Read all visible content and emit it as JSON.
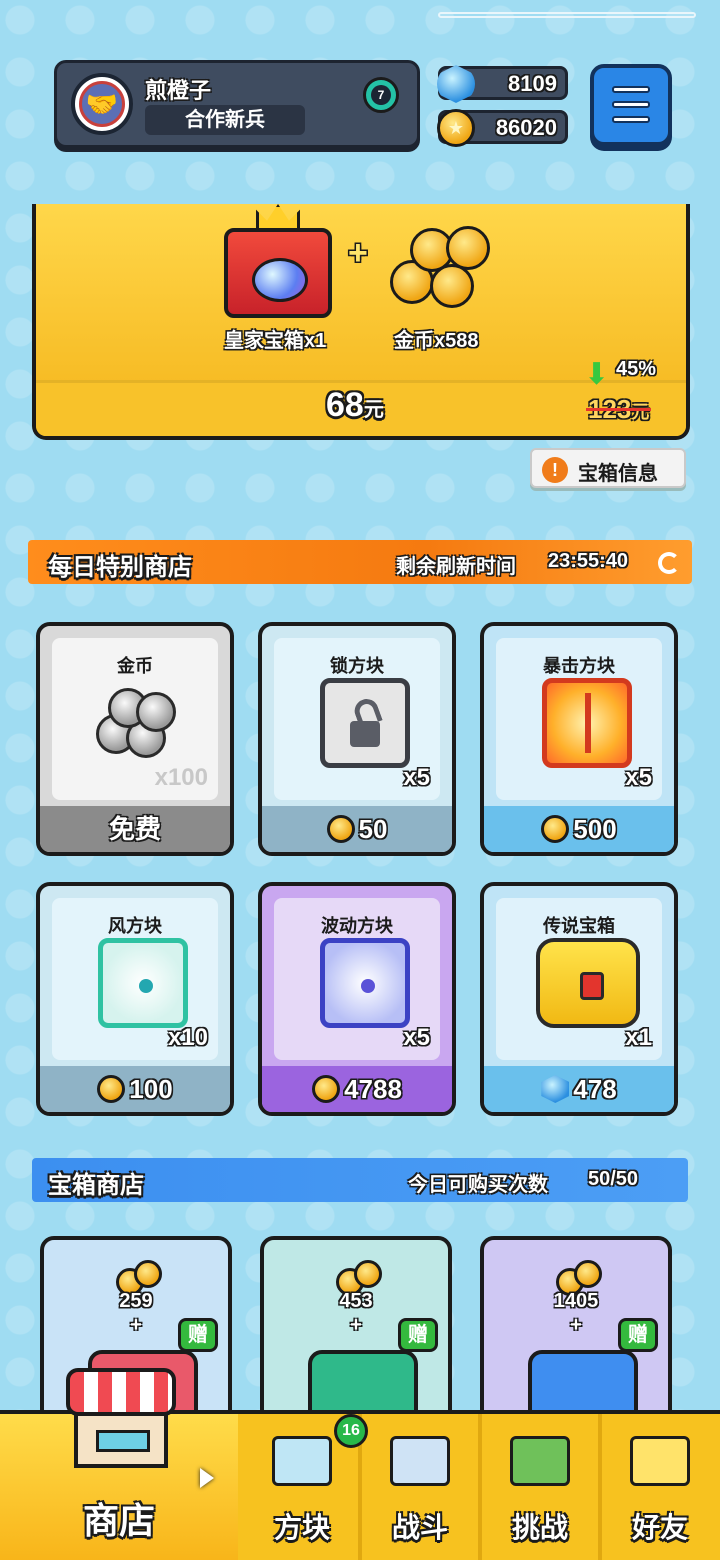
{
  "player": {
    "name": "煎橙子",
    "rank": "合作新兵",
    "level_badge": "7"
  },
  "currency": {
    "gems": "8109",
    "coins": "86020"
  },
  "offer": {
    "item1_label": "皇家宝箱x1",
    "item2_label": "金币x588",
    "price": "68",
    "price_unit": "元",
    "discount": "45%",
    "original_price": "123",
    "original_unit": "元"
  },
  "chest_info_label": "宝箱信息",
  "daily_shop": {
    "title": "每日特别商店",
    "refresh_label": "剩余刷新时间",
    "refresh_time": "23:55:40",
    "items": [
      {
        "name": "金币",
        "qty": "x100",
        "price": "免费",
        "icon": "silver-coins-icon",
        "currency": "none"
      },
      {
        "name": "锁方块",
        "qty": "x5",
        "price": "50",
        "icon": "lock-block-icon",
        "currency": "coin"
      },
      {
        "name": "暴击方块",
        "qty": "x5",
        "price": "500",
        "icon": "crit-block-icon",
        "currency": "coin"
      },
      {
        "name": "风方块",
        "qty": "x10",
        "price": "100",
        "icon": "wind-block-icon",
        "currency": "coin"
      },
      {
        "name": "波动方块",
        "qty": "x5",
        "price": "4788",
        "icon": "wave-block-icon",
        "currency": "coin"
      },
      {
        "name": "传说宝箱",
        "qty": "x1",
        "price": "478",
        "icon": "legendary-chest-icon",
        "currency": "gem"
      }
    ]
  },
  "chest_shop": {
    "title": "宝箱商店",
    "limit_label": "今日可购买次数",
    "limit_value": "50/50",
    "chests": [
      {
        "bonus_coins": "259",
        "plus": "+",
        "gift_label": "赠",
        "color": "#e9596a"
      },
      {
        "bonus_coins": "453",
        "plus": "+",
        "gift_label": "赠",
        "color": "#2fb98a"
      },
      {
        "bonus_coins": "1405",
        "plus": "+",
        "gift_label": "赠",
        "color": "#3f8ef0"
      }
    ]
  },
  "nav": {
    "shop": "商店",
    "blocks": "方块",
    "blocks_badge": "16",
    "battle": "战斗",
    "challenge": "挑战",
    "friends": "好友"
  },
  "colors": {
    "accent_orange": "#f57a10",
    "accent_blue": "#3c8ff0",
    "nav_yellow": "#f7c21f"
  }
}
